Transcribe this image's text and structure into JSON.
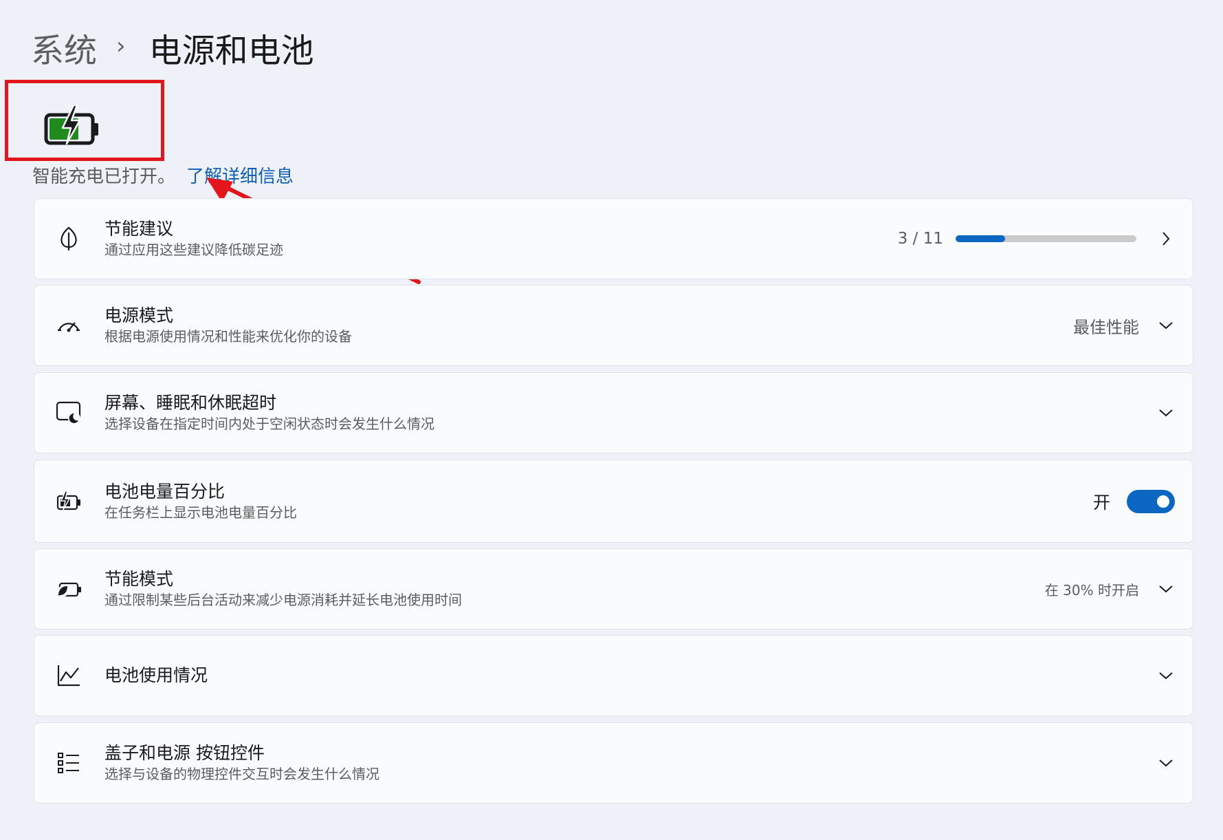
{
  "breadcrumb": {
    "parent": "系统",
    "separator": "›",
    "current": "电源和电池"
  },
  "battery_status": {
    "charge_percent": 70,
    "charging": true,
    "color": "#1f8b1f"
  },
  "smart_charging": {
    "text": "智能充电已打开。",
    "link": "了解详细信息"
  },
  "annotation": {
    "box_color": "#e3161b",
    "arrow_color": "#e3161b"
  },
  "accent_color": "#0c67c2",
  "settings": [
    {
      "id": "energy",
      "icon": "leaf-icon",
      "title": "节能建议",
      "subtitle": "通过应用这些建议降低碳足迹",
      "progress_label": "3 / 11",
      "progress_done": 3,
      "progress_total": 11
    },
    {
      "id": "power-mode",
      "icon": "speedometer-icon",
      "title": "电源模式",
      "subtitle": "根据电源使用情况和性能来优化你的设备",
      "value": "最佳性能"
    },
    {
      "id": "screen-sleep",
      "icon": "screen-sleep-icon",
      "title": "屏幕、睡眠和休眠超时",
      "subtitle": "选择设备在指定时间内处于空闲状态时会发生什么情况"
    },
    {
      "id": "battery-percent",
      "icon": "battery-charging-icon",
      "title": "电池电量百分比",
      "subtitle": "在任务栏上显示电池电量百分比",
      "toggle_label": "开",
      "toggle_on": true
    },
    {
      "id": "battery-saver",
      "icon": "battery-saver-icon",
      "title": "节能模式",
      "subtitle": "通过限制某些后台活动来减少电源消耗并延长电池使用时间",
      "value": "在 30% 时开启"
    },
    {
      "id": "battery-usage",
      "icon": "line-chart-icon",
      "title": "电池使用情况"
    },
    {
      "id": "lid-buttons",
      "icon": "list-icon",
      "title": "盖子和电源 按钮控件",
      "subtitle": "选择与设备的物理控件交互时会发生什么情况"
    }
  ]
}
